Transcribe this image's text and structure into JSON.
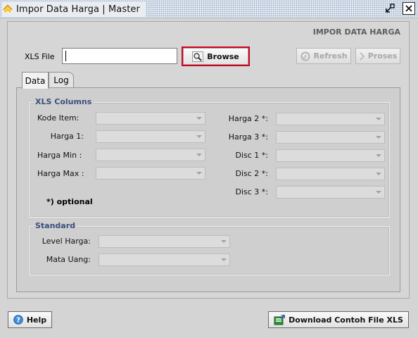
{
  "window": {
    "title": "Impor Data Harga | Master",
    "app_icon": "app-logo-icon",
    "restore_icon": "restore-window-icon",
    "close_icon": "close-icon"
  },
  "header": {
    "title": "IMPOR DATA HARGA"
  },
  "file_picker": {
    "label": "XLS File",
    "value": "",
    "browse_label": "Browse",
    "browse_icon": "magnifier-icon",
    "refresh_label": "Refresh",
    "refresh_icon": "refresh-icon",
    "proses_label": "Proses",
    "proses_icon": "chevron-right-icon"
  },
  "tabs": [
    {
      "label": "Data",
      "active": true
    },
    {
      "label": "Log",
      "active": false
    }
  ],
  "xls_columns": {
    "legend": "XLS Columns",
    "left_fields": [
      {
        "label": "Kode Item:",
        "value": ""
      },
      {
        "label": "Harga 1:",
        "value": ""
      },
      {
        "label": "Harga Min :",
        "value": ""
      },
      {
        "label": "Harga Max :",
        "value": ""
      }
    ],
    "right_fields": [
      {
        "label": "Harga 2 *:",
        "value": ""
      },
      {
        "label": "Harga 3 *:",
        "value": ""
      },
      {
        "label": "Disc 1 *:",
        "value": ""
      },
      {
        "label": "Disc 2 *:",
        "value": ""
      },
      {
        "label": "Disc 3 *:",
        "value": ""
      }
    ],
    "optional_note": "*) optional"
  },
  "standard": {
    "legend": "Standard",
    "fields": [
      {
        "label": "Level Harga:",
        "value": ""
      },
      {
        "label": "Mata Uang:",
        "value": ""
      }
    ]
  },
  "footer": {
    "help_label": "Help",
    "help_icon": "help-icon",
    "download_label": "Download Contoh File XLS",
    "download_icon": "download-excel-icon"
  },
  "colors": {
    "accent_red": "#d1001f",
    "legend_blue": "#3b4f7d",
    "header_gray": "#5e5e5e"
  }
}
